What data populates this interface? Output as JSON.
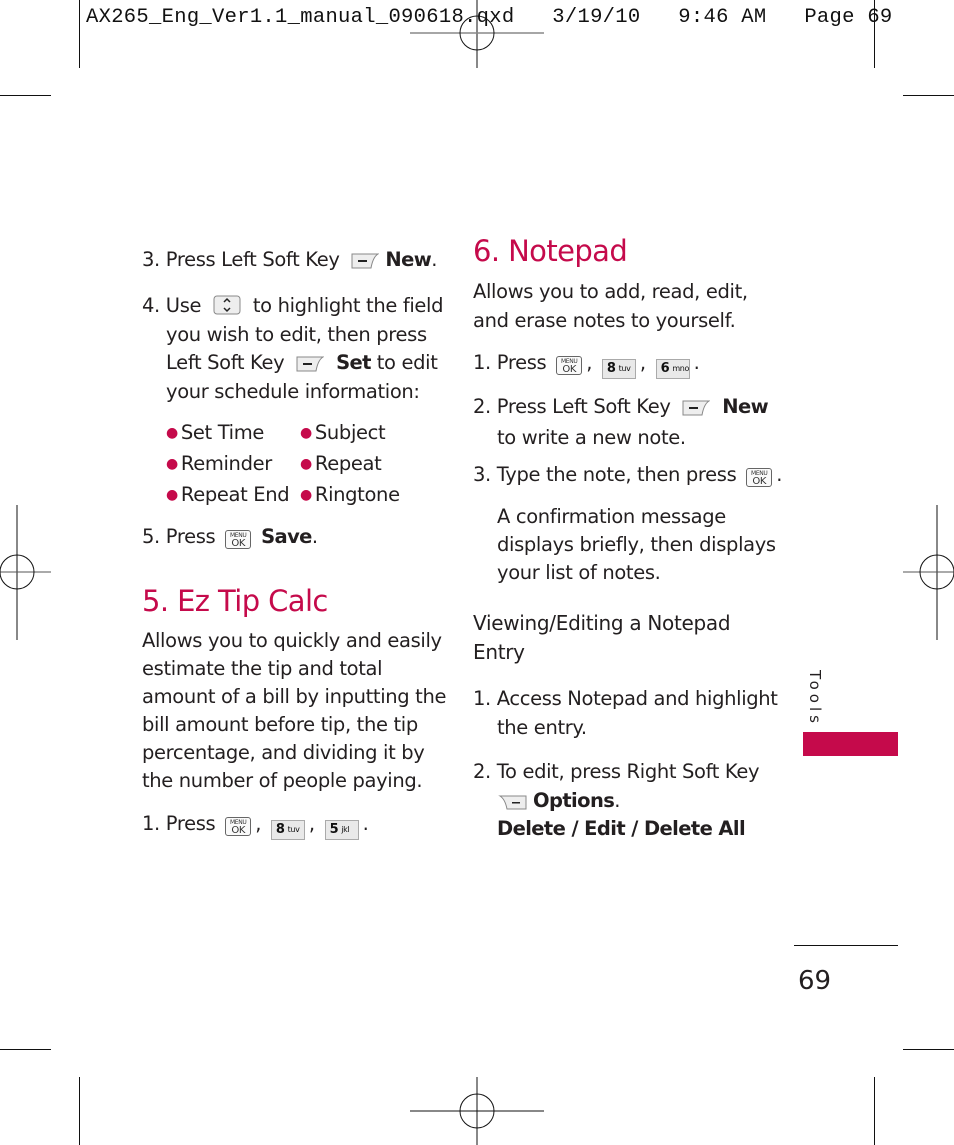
{
  "slug": {
    "text": "AX265_Eng_Ver1.1_manual_090618.qxd   3/19/10   9:46 AM   Page 69"
  },
  "left_column": {
    "step3": {
      "num": "3.",
      "pre": "Press Left Soft Key",
      "bold": "New",
      "post": "."
    },
    "step4": {
      "num": "4.",
      "line1_pre": "Use",
      "line1_post": "to highlight the field",
      "line2": "you wish to edit, then press",
      "line3_pre": "Left Soft Key",
      "line3_bold": "Set",
      "line3_post": "to edit",
      "line4": "your schedule information:"
    },
    "bullets": [
      [
        "Set Time",
        "Subject"
      ],
      [
        "Reminder",
        "Repeat"
      ],
      [
        "Repeat End",
        "Ringtone"
      ]
    ],
    "step5": {
      "num": "5.",
      "pre": "Press",
      "bold": "Save",
      "post": "."
    },
    "section5": {
      "title": "5. Ez Tip Calc",
      "desc": [
        "Allows you to quickly and easily",
        "estimate the tip and total",
        "amount of a bill by inputting the",
        "bill amount before tip, the tip",
        "percentage, and dividing it by",
        "the number of people paying."
      ],
      "step1": {
        "num": "1.",
        "pre": "Press",
        "keys": [
          "MENU OK",
          "8 tuv",
          "5 jkl"
        ]
      }
    }
  },
  "right_column": {
    "section6": {
      "title": "6. Notepad",
      "desc": [
        "Allows you to add, read, edit,",
        "and erase notes to yourself."
      ],
      "step1": {
        "num": "1.",
        "pre": "Press",
        "keys": [
          "MENU OK",
          "8 tuv",
          "6 mno"
        ]
      },
      "step2": {
        "num": "2.",
        "pre": "Press Left Soft Key",
        "bold": "New",
        "line2": "to write a new note."
      },
      "step3": {
        "num": "3.",
        "pre": "Type the note, then press",
        "post": "."
      },
      "note": [
        "A confirmation message",
        "displays briefly, then displays",
        "your list of notes."
      ],
      "subheading": [
        "Viewing/Editing a Notepad",
        "Entry"
      ],
      "sub_step1": {
        "num": "1.",
        "line1": "Access Notepad and highlight",
        "line2": "the entry."
      },
      "sub_step2": {
        "num": "2.",
        "line1": "To edit, press Right Soft Key",
        "bold": "Options",
        "post": ".",
        "options": "Delete / Edit / Delete All"
      }
    }
  },
  "keys": {
    "menu_top": "MENU",
    "menu_ok": "OK",
    "k8": "8",
    "k8_sub": "tuv",
    "k5": "5",
    "k5_sub": "jkl",
    "k6": "6",
    "k6_sub": "mno"
  },
  "side_tab": {
    "label": "Tools",
    "color": "#c50a4b"
  },
  "page_number": "69",
  "accent_color": "#c50a4b"
}
